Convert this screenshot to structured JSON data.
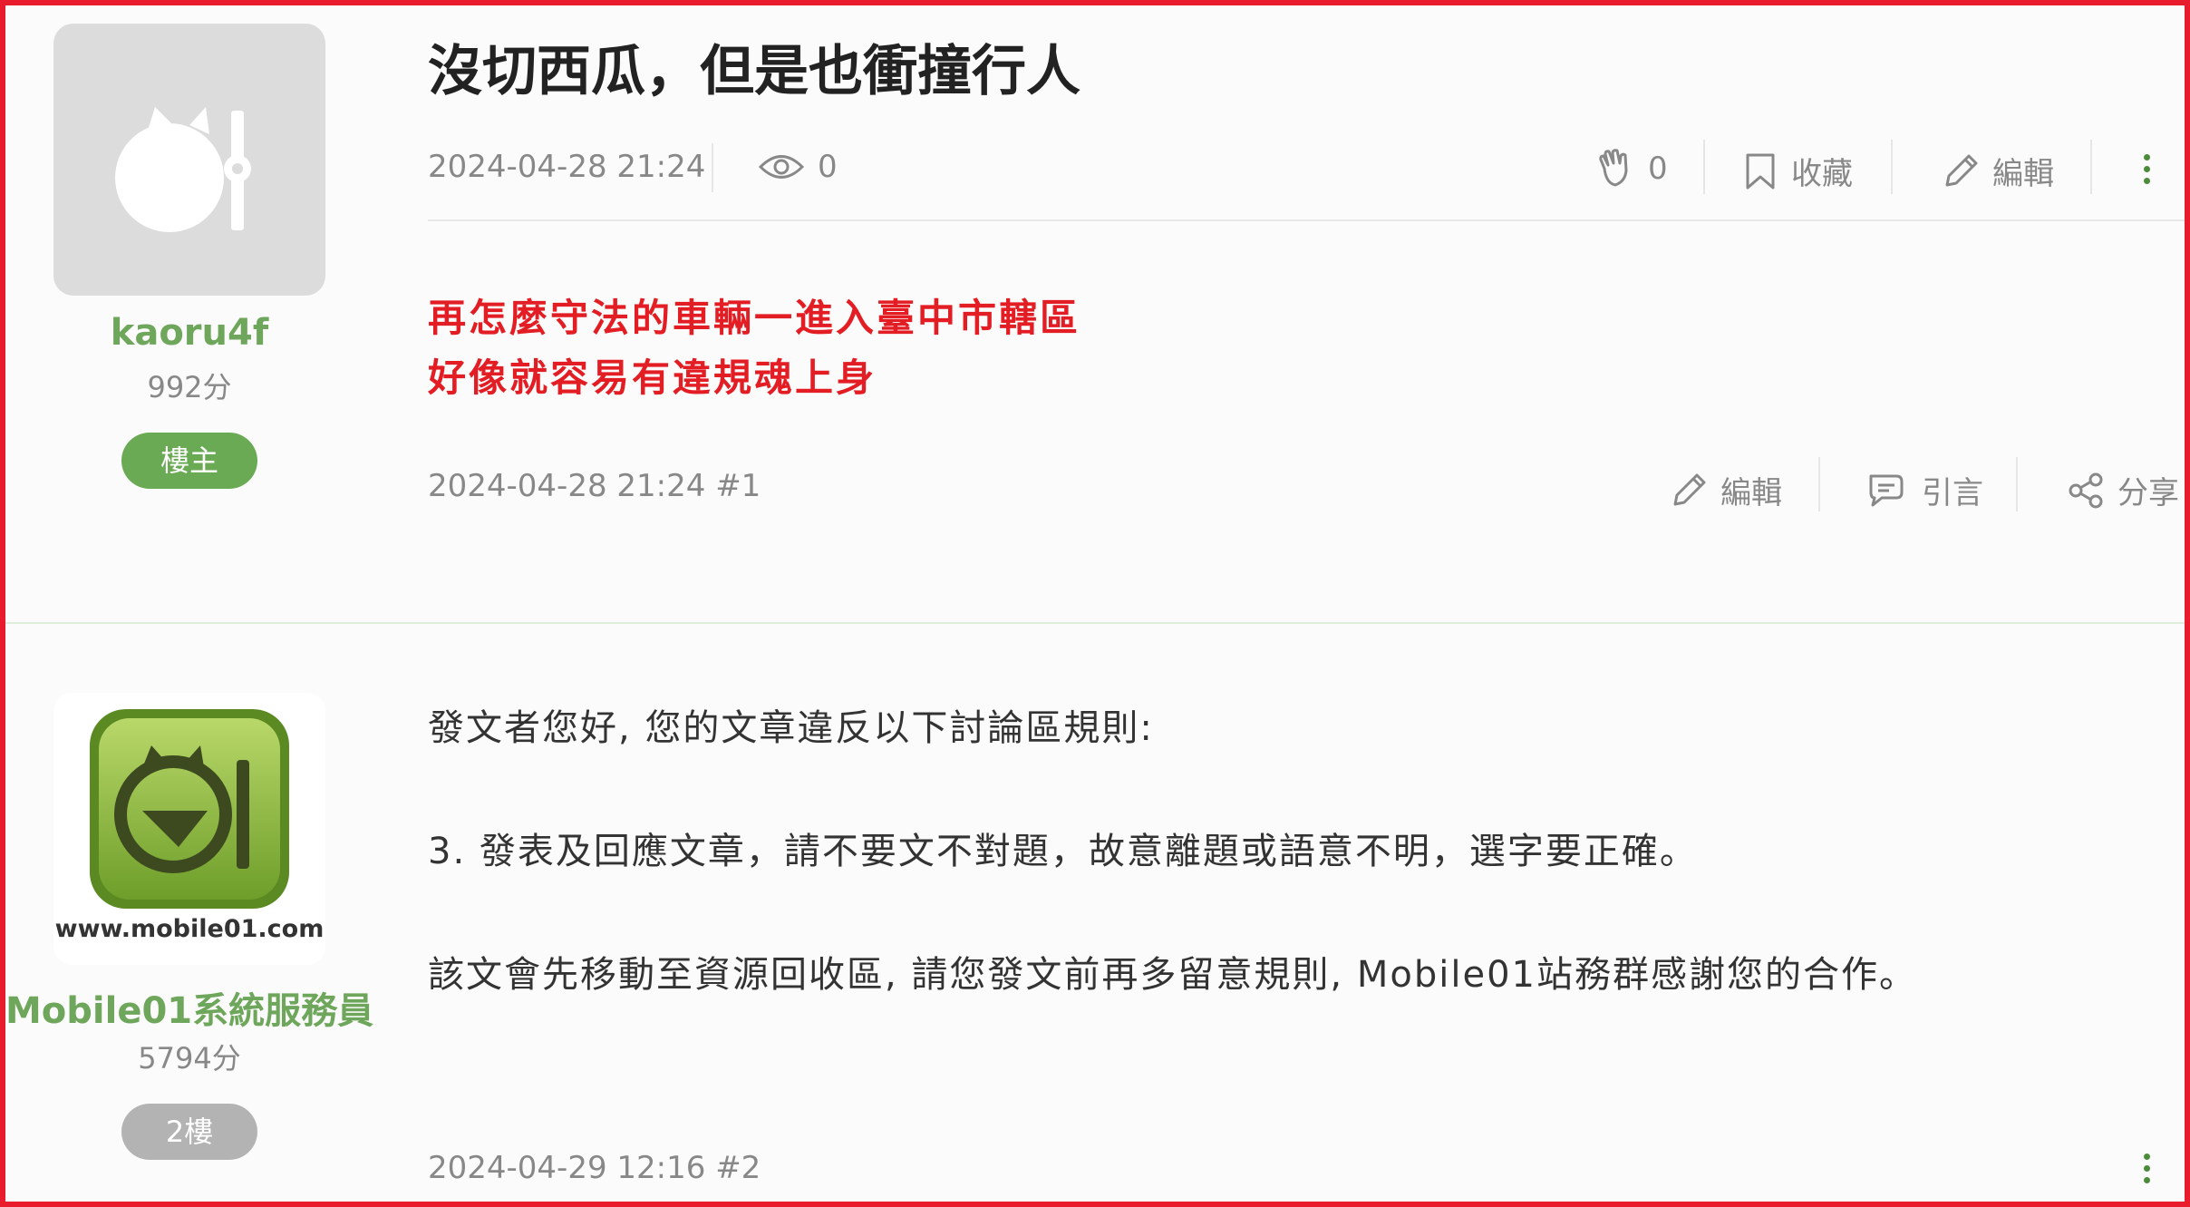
{
  "thread": {
    "title": "沒切西瓜，但是也衝撞行人",
    "datetime": "2024-04-28 21:24",
    "views": "0",
    "likes": "0",
    "bookmark_label": "收藏",
    "edit_label": "編輯"
  },
  "posts": [
    {
      "username": "kaoru4f",
      "score": "992分",
      "badge": "樓主",
      "badge_color": "#6aaa55",
      "content_lines": [
        "再怎麼守法的車輛一進入臺中市轄區",
        "好像就容易有違規魂上身"
      ],
      "footer": "2024-04-28 21:24 #1",
      "actions": {
        "edit": "編輯",
        "quote": "引言",
        "share": "分享"
      }
    },
    {
      "username": "Mobile01系統服務員",
      "score": "5794分",
      "badge": "2樓",
      "badge_color": "#b3b3b3",
      "avatar_caption": "www.mobile01.com",
      "content_lines": [
        "發文者您好, 您的文章違反以下討論區規則:",
        "3. 發表及回應文章，請不要文不對題，故意離題或語意不明，選字要正確。",
        "該文會先移動至資源回收區, 請您發文前再多留意規則, Mobile01站務群感謝您的合作。"
      ],
      "footer": "2024-04-29 12:16 #2"
    }
  ],
  "colors": {
    "frame": "#e81c2c",
    "username": "#6ea75b",
    "warning_text": "#e31d24",
    "menu_dots": "#4a8c3a"
  }
}
